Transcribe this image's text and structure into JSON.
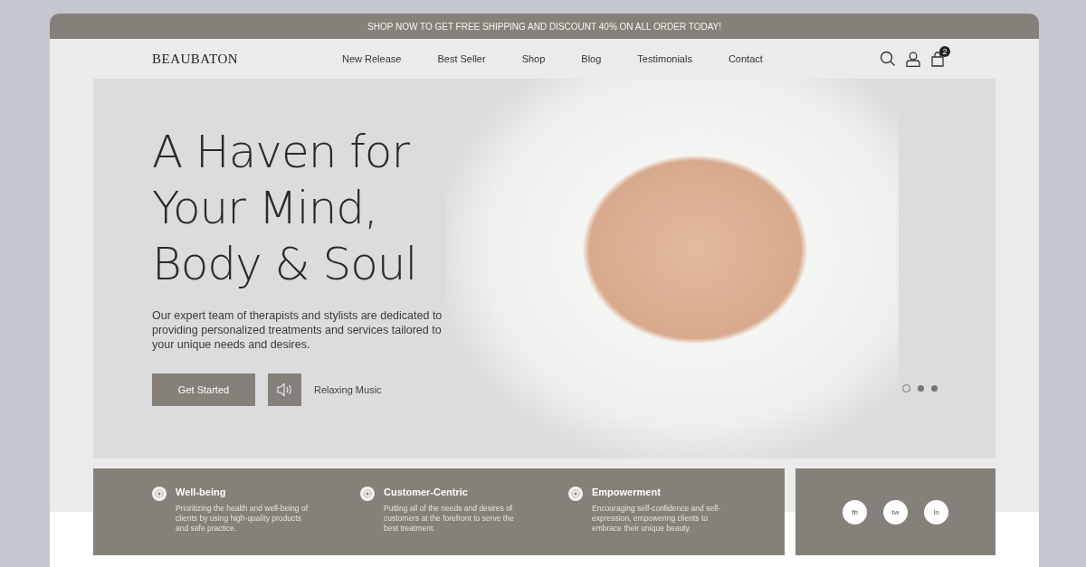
{
  "announcement": "SHOP NOW TO GET FREE SHIPPING AND DISCOUNT 40% ON ALL ORDER TODAY!",
  "logo": "BEAUBATON",
  "nav": [
    {
      "label": "New Release"
    },
    {
      "label": "Best Seller"
    },
    {
      "label": "Shop"
    },
    {
      "label": "Blog"
    },
    {
      "label": "Testimonials"
    },
    {
      "label": "Contact"
    }
  ],
  "cart_count": "2",
  "hero": {
    "title_lines": [
      "A Haven for",
      "Your Mind,",
      "Body & Soul"
    ],
    "description": "Our expert team of therapists and stylists are dedicated to providing personalized treatments and services tailored to your unique needs and desires.",
    "primary_button": "Get Started",
    "music_label": "Relaxing Music",
    "slides": [
      {
        "selected": true
      },
      {
        "selected": false
      },
      {
        "selected": false
      }
    ]
  },
  "features": [
    {
      "title": "Well-being",
      "text": "Prioritizing the health and well-being of clients by using high-quality products and safe practice."
    },
    {
      "title": "Customer-Centric",
      "text": "Putting all of the needs and desires of customers at the forefront to serve the best treatment."
    },
    {
      "title": "Empowerment",
      "text": "Encouraging self-confidence and self-expression, empowering clients to embrace their unique beauty."
    }
  ],
  "social": [
    "fb",
    "tw",
    "in"
  ]
}
